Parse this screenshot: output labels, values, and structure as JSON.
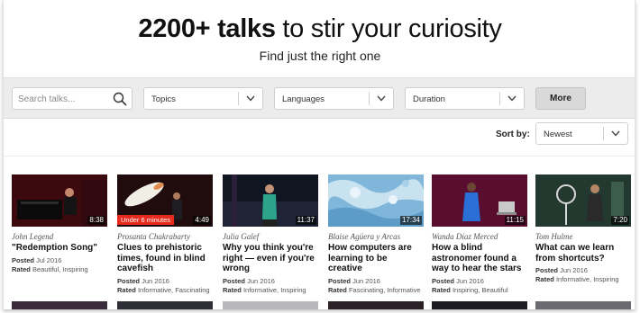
{
  "hero": {
    "title_bold": "2200+ talks",
    "title_rest": " to stir your curiosity",
    "subtitle": "Find just the right one"
  },
  "filters": {
    "search_placeholder": "Search talks...",
    "topics": "Topics",
    "languages": "Languages",
    "duration": "Duration",
    "more": "More"
  },
  "sort": {
    "label": "Sort by:",
    "value": "Newest"
  },
  "talks": [
    {
      "speaker": "John Legend",
      "title": "\"Redemption Song\"",
      "posted_label": "Posted",
      "posted": "Jul 2016",
      "rated_label": "Rated",
      "rated": "Beautiful, Inspiring",
      "duration": "8:38",
      "badge": ""
    },
    {
      "speaker": "Prosanta Chakrabarty",
      "title": "Clues to prehistoric times, found in blind cavefish",
      "posted_label": "Posted",
      "posted": "Jun 2016",
      "rated_label": "Rated",
      "rated": "Informative, Fascinating",
      "duration": "4:49",
      "badge": "Under 6 minutes"
    },
    {
      "speaker": "Julia Galef",
      "title": "Why you think you're right — even if you're wrong",
      "posted_label": "Posted",
      "posted": "Jun 2016",
      "rated_label": "Rated",
      "rated": "Informative, Inspiring",
      "duration": "11:37",
      "badge": ""
    },
    {
      "speaker": "Blaise Agüera y Arcas",
      "title": "How computers are learning to be creative",
      "posted_label": "Posted",
      "posted": "Jun 2016",
      "rated_label": "Rated",
      "rated": "Fascinating, Informative",
      "duration": "17:34",
      "badge": ""
    },
    {
      "speaker": "Wanda Díaz Merced",
      "title": "How a blind astronomer found a way to hear the stars",
      "posted_label": "Posted",
      "posted": "Jun 2016",
      "rated_label": "Rated",
      "rated": "Inspiring, Beautiful",
      "duration": "11:15",
      "badge": ""
    },
    {
      "speaker": "Tom Hulme",
      "title": "What can we learn from shortcuts?",
      "posted_label": "Posted",
      "posted": "Jun 2016",
      "rated_label": "Rated",
      "rated": "Informative, Inspiring",
      "duration": "7:20",
      "badge": ""
    }
  ]
}
